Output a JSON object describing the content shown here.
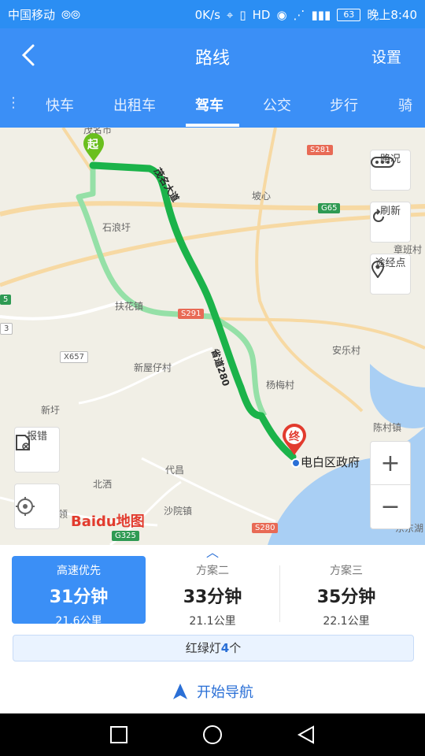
{
  "status_bar": {
    "carrier": "中国移动",
    "speed": "0K/s",
    "battery": "63",
    "time": "晚上8:40"
  },
  "header": {
    "title": "路线",
    "settings_label": "设置"
  },
  "tabs": [
    {
      "label": "快车"
    },
    {
      "label": "出租车"
    },
    {
      "label": "驾车"
    },
    {
      "label": "公交"
    },
    {
      "label": "步行"
    },
    {
      "label": "骑"
    }
  ],
  "map": {
    "labels": {
      "start_town": "茂名市",
      "shilangyu": "石浪圩",
      "fuhuazhen": "扶花镇",
      "xinwuzi": "新屋仔村",
      "xinyu": "新圩",
      "beixi": "北洒",
      "daichang": "代昌",
      "shayuanzhen": "沙院镇",
      "anle": "安乐村",
      "yangmei": "杨梅村",
      "chenlin": "陈村镇",
      "boxin": "坡心",
      "zhangban": "章班村",
      "dongxi": "东东湖",
      "ling": "领"
    },
    "road_labels": {
      "maoming_avenue": "茂名大道",
      "provincial_280": "省道280"
    },
    "shields": {
      "s281": "S281",
      "g65": "G65",
      "s291": "S291",
      "x657": "X657",
      "s280": "S280",
      "g325": "G325",
      "num5": "5",
      "num3": "3"
    },
    "controls": {
      "traffic": "路况",
      "refresh": "刷新",
      "waypoints": "途经点",
      "report": "报错"
    },
    "start_marker": "起",
    "end_marker": "终",
    "destination": "电白区政府",
    "logo": "Baidu地图"
  },
  "plans": [
    {
      "label": "高速优先",
      "duration": "31分钟",
      "distance": "21.6公里"
    },
    {
      "label": "方案二",
      "duration": "33分钟",
      "distance": "21.1公里"
    },
    {
      "label": "方案三",
      "duration": "35分钟",
      "distance": "22.1公里"
    }
  ],
  "traffic_lights": {
    "prefix": "红绿灯",
    "count": "4",
    "suffix": "个"
  },
  "navigation": {
    "start_label": "开始导航"
  },
  "colors": {
    "primary": "#3b8ff6",
    "route_main": "#1bb34a",
    "route_alt": "#95e0a7",
    "end_marker": "#e23b2e",
    "start_marker": "#6abf1e"
  },
  "icons": {
    "back": "back-arrow-icon",
    "traffic": "traffic-icon",
    "refresh": "refresh-icon",
    "waypoints": "location-pin-icon",
    "report": "report-icon",
    "locate": "locate-icon",
    "zoom_in": "zoom-in-icon",
    "zoom_out": "zoom-out-icon",
    "nav_arrow": "navigation-arrow-icon"
  }
}
